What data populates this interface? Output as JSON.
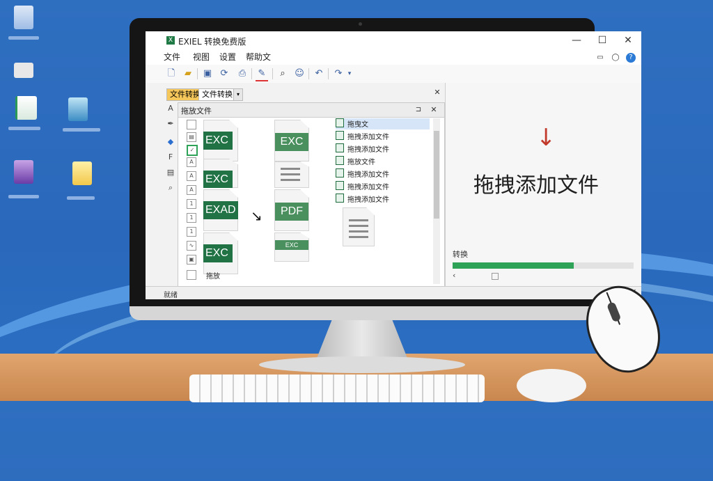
{
  "colors": {
    "accent_green": "#217346",
    "progress_green": "#2ea357",
    "desktop_blue": "#2f6fc0",
    "arrow_red": "#c23a2b"
  },
  "window": {
    "title": "EXIEL 转换免费版",
    "controls": {
      "minimize": "—",
      "maximize": "☐",
      "close": "✕",
      "help": "?"
    }
  },
  "menu": [
    "文件",
    "视图",
    "设置",
    "帮助文"
  ],
  "toolbar": {
    "icons": [
      "new-file-icon",
      "open-folder-icon",
      "save-icon",
      "convert-icon",
      "print-icon",
      "edit-icon",
      "search-icon",
      "user-icon",
      "undo-icon",
      "redo-icon"
    ]
  },
  "tabs": [
    "文件转换",
    "文件转换"
  ],
  "file_window": {
    "title": "拖放文件",
    "pin": "⊐",
    "close": "✕"
  },
  "file_icons": [
    {
      "badge": "EXC"
    },
    {
      "badge": "EXC"
    },
    {
      "badge": "EXC"
    },
    {
      "badge": "EXAD"
    },
    {
      "badge": "EXC"
    },
    {
      "badge": "EXC"
    },
    {
      "badge": "PDF"
    },
    {
      "badge": "EXC"
    }
  ],
  "file_list": [
    "拖曳文",
    "拖拽添加文件",
    "拖拽添加文件",
    "拖放文件",
    "拖拽添加文件",
    "拖拽添加文件",
    "拖拽添加文件"
  ],
  "bottom_label": "拖放",
  "drop_zone": {
    "arrow": "↓",
    "text": "拖拽添加文件"
  },
  "conversion": {
    "label": "转换",
    "progress": 0.67
  },
  "status": {
    "text": "就绪"
  }
}
